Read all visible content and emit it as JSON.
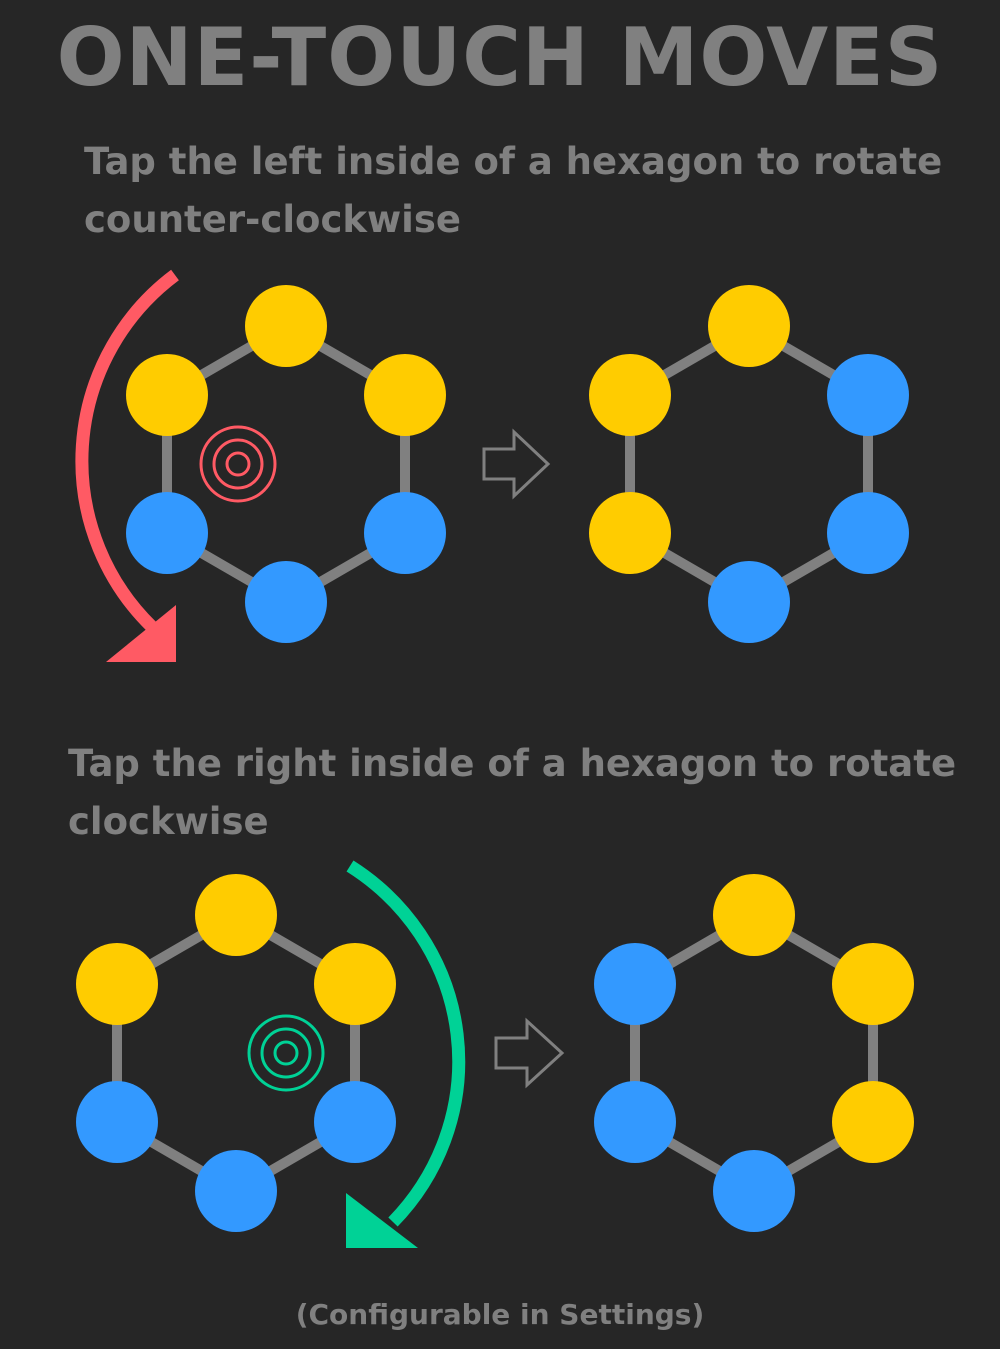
{
  "title": "ONE-TOUCH MOVES",
  "instructions": {
    "left_rotation": "Tap the left inside of a hexagon to rotate counter-clockwise",
    "right_rotation": "Tap the right inside of a hexagon to rotate clockwise"
  },
  "footer": "(Configurable in Settings)",
  "colors": {
    "background": "#262626",
    "text": "#808080",
    "yellow": "#ffcc00",
    "blue": "#3399ff",
    "edge": "#808080",
    "ccw_arrow": "#ff5a64",
    "cw_arrow": "#00d296"
  },
  "examples": {
    "counter_clockwise": {
      "before": [
        "yellow",
        "yellow",
        "blue",
        "blue",
        "blue",
        "yellow"
      ],
      "after": [
        "yellow",
        "blue",
        "blue",
        "blue",
        "yellow",
        "yellow"
      ],
      "tap_side": "left",
      "rotation": "counter-clockwise"
    },
    "clockwise": {
      "before": [
        "yellow",
        "yellow",
        "blue",
        "blue",
        "blue",
        "yellow"
      ],
      "after": [
        "yellow",
        "yellow",
        "yellow",
        "blue",
        "blue",
        "blue"
      ],
      "tap_side": "right",
      "rotation": "clockwise"
    }
  },
  "node_order": [
    "top",
    "upper-right",
    "lower-right",
    "bottom",
    "lower-left",
    "upper-left"
  ]
}
